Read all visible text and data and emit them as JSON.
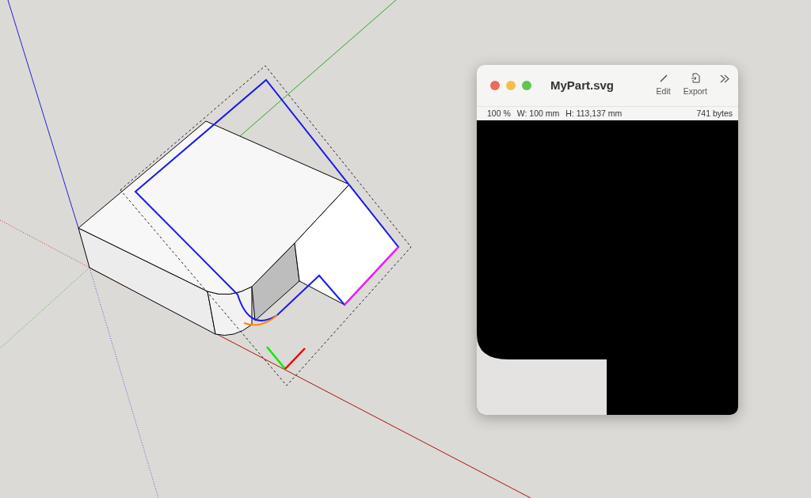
{
  "preview_window": {
    "title": "MyPart.svg",
    "toolbar": [
      {
        "kind": "edit",
        "label": "Edit"
      },
      {
        "kind": "export",
        "label": "Export"
      }
    ],
    "info": {
      "zoom": "100 %",
      "width": "W: 100 mm",
      "height": "H: 113,137 mm",
      "file_size": "741 bytes"
    }
  }
}
